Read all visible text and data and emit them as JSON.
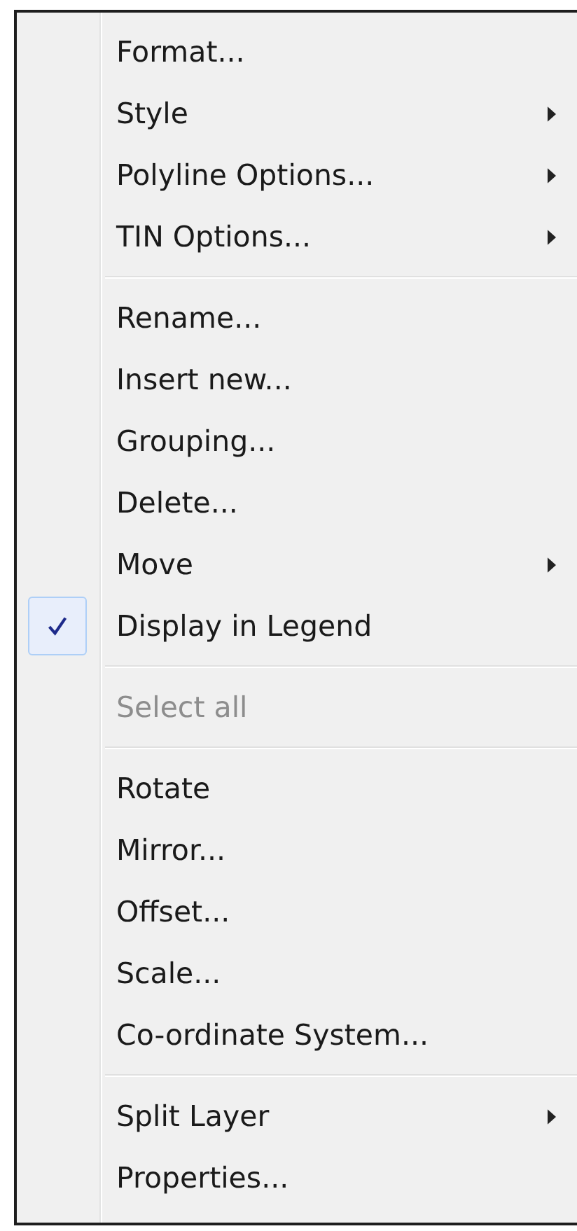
{
  "menu": {
    "items": [
      {
        "kind": "item",
        "label": "Format...",
        "submenu": false,
        "checked": false,
        "disabled": false
      },
      {
        "kind": "item",
        "label": "Style",
        "submenu": true,
        "checked": false,
        "disabled": false
      },
      {
        "kind": "item",
        "label": "Polyline Options...",
        "submenu": true,
        "checked": false,
        "disabled": false
      },
      {
        "kind": "item",
        "label": "TIN Options...",
        "submenu": true,
        "checked": false,
        "disabled": false
      },
      {
        "kind": "separator"
      },
      {
        "kind": "item",
        "label": "Rename...",
        "submenu": false,
        "checked": false,
        "disabled": false
      },
      {
        "kind": "item",
        "label": "Insert new...",
        "submenu": false,
        "checked": false,
        "disabled": false
      },
      {
        "kind": "item",
        "label": "Grouping...",
        "submenu": false,
        "checked": false,
        "disabled": false
      },
      {
        "kind": "item",
        "label": "Delete...",
        "submenu": false,
        "checked": false,
        "disabled": false
      },
      {
        "kind": "item",
        "label": "Move",
        "submenu": true,
        "checked": false,
        "disabled": false
      },
      {
        "kind": "item",
        "label": "Display in Legend",
        "submenu": false,
        "checked": true,
        "disabled": false
      },
      {
        "kind": "separator"
      },
      {
        "kind": "item",
        "label": "Select all",
        "submenu": false,
        "checked": false,
        "disabled": true
      },
      {
        "kind": "separator"
      },
      {
        "kind": "item",
        "label": "Rotate",
        "submenu": false,
        "checked": false,
        "disabled": false
      },
      {
        "kind": "item",
        "label": "Mirror...",
        "submenu": false,
        "checked": false,
        "disabled": false
      },
      {
        "kind": "item",
        "label": "Offset...",
        "submenu": false,
        "checked": false,
        "disabled": false
      },
      {
        "kind": "item",
        "label": "Scale...",
        "submenu": false,
        "checked": false,
        "disabled": false
      },
      {
        "kind": "item",
        "label": "Co-ordinate System...",
        "submenu": false,
        "checked": false,
        "disabled": false
      },
      {
        "kind": "separator"
      },
      {
        "kind": "item",
        "label": "Split Layer",
        "submenu": true,
        "checked": false,
        "disabled": false
      },
      {
        "kind": "item",
        "label": "Properties...",
        "submenu": false,
        "checked": false,
        "disabled": false
      }
    ]
  }
}
